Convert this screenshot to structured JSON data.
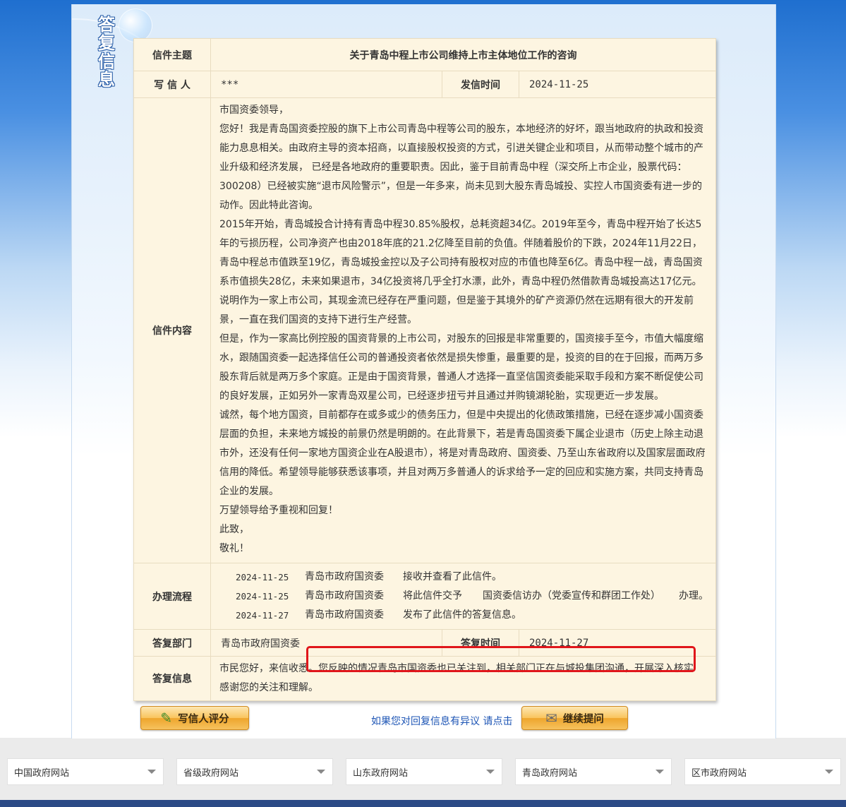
{
  "side_title": "答复信息",
  "labels": {
    "subject": "信件主题",
    "writer": "写 信 人",
    "send_time": "发信时间",
    "content": "信件内容",
    "process": "办理流程",
    "reply_dept": "答复部门",
    "reply_time": "答复时间",
    "reply_info": "答复信息"
  },
  "letter": {
    "subject": "关于青岛中程上市公司维持上市主体地位工作的咨询",
    "writer": "***",
    "send_time": "2024-11-25",
    "content_lines": [
      "市国资委领导，",
      "您好！我是青岛国资委控股的旗下上市公司青岛中程等公司的股东，本地经济的好坏，跟当地政府的执政和投资能力息息相关。由政府主导的资本招商，以直接股权投资的方式，引进关键企业和项目，从而带动整个城市的产业升级和经济发展， 已经是各地政府的重要职责。因此，鉴于目前青岛中程（深交所上市企业，股票代码：300208）已经被实施“退市风险警示”，但是一年多来，尚未见到大股东青岛城投、实控人市国资委有进一步的动作。因此特此咨询。",
      "2015年开始，青岛城投合计持有青岛中程30.85%股权，总耗资超34亿。2019年至今，青岛中程开始了长达5年的亏损历程，公司净资产也由2018年底的21.2亿降至目前的负值。伴随着股价的下跌，2024年11月22日，青岛中程总市值跌至19亿，青岛城投金控以及子公司持有股权对应的市值也降至6亿。青岛中程一战，青岛国资系市值损失28亿，未来如果退市，34亿投资将几乎全打水漂，此外，青岛中程仍然借款青岛城投高达17亿元。说明作为一家上市公司，其现金流已经存在严重问题，但是鉴于其境外的矿产资源仍然在远期有很大的开发前景，一直在我们国资的支持下进行生产经营。",
      "但是，作为一家高比例控股的国资背景的上市公司，对股东的回报是非常重要的，国资接手至今，市值大幅度缩水，跟随国资委一起选择信任公司的普通投资者依然是损失惨重，最重要的是，投资的目的在于回报，而两万多股东背后就是两万多个家庭。正是由于国资背景，普通人才选择一直坚信国资委能采取手段和方案不断促使公司的良好发展，正如另外一家青岛双星公司，已经逐步扭亏并且通过并购镜湖轮胎，实现更近一步发展。",
      "诚然，每个地方国资，目前都存在或多或少的债务压力，但是中央提出的化债政策措施，已经在逐步减小国资委层面的负担，未来地方城投的前景仍然是明朗的。在此背景下，若是青岛国资委下属企业退市（历史上除主动退市外，还没有任何一家地方国资企业在A股退市），将是对青岛政府、国资委、乃至山东省政府以及国家层面政府信用的降低。希望领导能够获悉该事项，并且对两万多普通人的诉求给予一定的回应和实施方案，共同支持青岛企业的发展。",
      "万望领导给予重视和回复！",
      "此致，",
      "敬礼！"
    ]
  },
  "process": [
    {
      "date": "2024-11-25",
      "dept": "青岛市政府国资委",
      "action": "接收并查看了此信件。",
      "target": "",
      "suffix": ""
    },
    {
      "date": "2024-11-25",
      "dept": "青岛市政府国资委",
      "action": "将此信件交予",
      "target": "国资委信访办（党委宣传和群团工作处）",
      "suffix": "办理。"
    },
    {
      "date": "2024-11-27",
      "dept": "青岛市政府国资委",
      "action": "发布了此信件的答复信息。",
      "target": "",
      "suffix": ""
    }
  ],
  "reply": {
    "dept": "青岛市政府国资委",
    "time": "2024-11-27",
    "line1": "市民您好，来信收悉。您反映的情况青岛市国资委也已关注到，相关部门正在与城投集团沟通，开展深入核实",
    "line2": "感谢您的关注和理解。"
  },
  "actions": {
    "rate_label": "写信人评分",
    "objection_text": "如果您对回复信息有异议 请点击",
    "continue_label": "继续提问"
  },
  "footer_links": [
    "中国政府网站",
    "省级政府网站",
    "山东政府网站",
    "青岛政府网站",
    "区市政府网站"
  ],
  "colors": {
    "label_blue": "#1f5aa6",
    "table_bg": "#fdf5e1",
    "highlight_red": "#e0161b"
  }
}
